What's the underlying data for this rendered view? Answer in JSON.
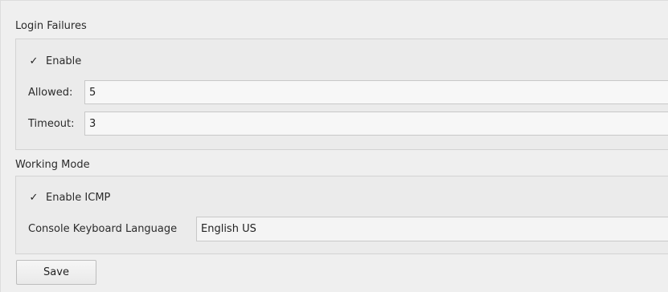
{
  "login_failures": {
    "title": "Login Failures",
    "enable_label": "Enable",
    "enable_checked_glyph": "✓",
    "allowed_label": "Allowed:",
    "allowed_value": "5",
    "timeout_label": "Timeout:",
    "timeout_value": "3"
  },
  "working_mode": {
    "title": "Working Mode",
    "enable_icmp_label": "Enable ICMP",
    "enable_icmp_checked_glyph": "✓",
    "keyboard_language_label": "Console Keyboard Language",
    "keyboard_language_value": "English US"
  },
  "actions": {
    "save_label": "Save"
  }
}
